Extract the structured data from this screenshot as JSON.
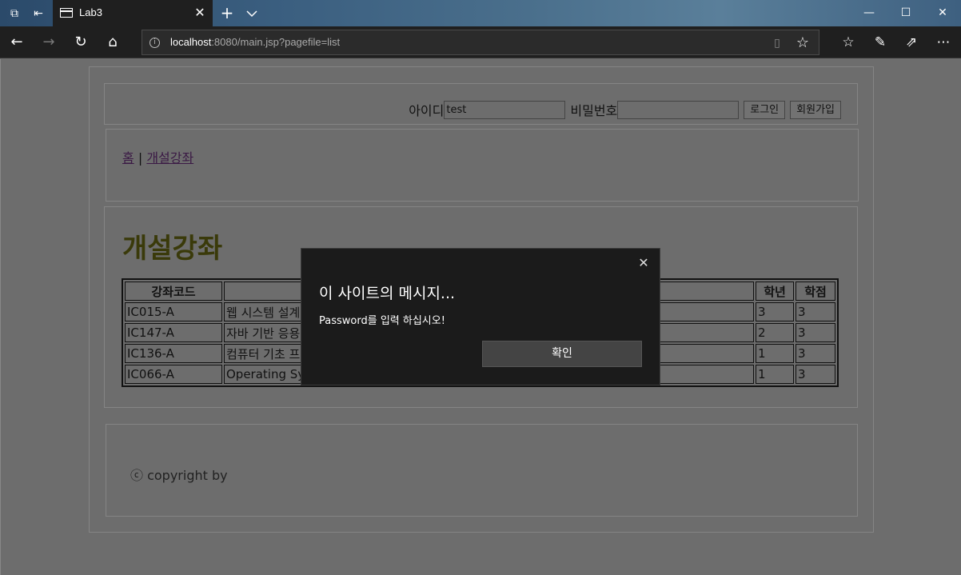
{
  "browser": {
    "tab_title": "Lab3",
    "url_host": "localhost",
    "url_rest": ":8080/main.jsp?pagefile=list"
  },
  "login": {
    "id_label": "아이디",
    "id_value": "test",
    "password_label": "비밀번호",
    "password_value": "",
    "login_button": "로그인",
    "signup_button": "회원가입"
  },
  "nav": {
    "home_link": "홈",
    "separator": "|",
    "courses_link": "개설강좌"
  },
  "content": {
    "heading": "개설강좌",
    "table": {
      "headers": [
        "강좌코드",
        "",
        "학년",
        "학점"
      ],
      "rows": [
        [
          "IC015-A",
          "웹 시스템 설계",
          "3",
          "3"
        ],
        [
          "IC147-A",
          "자바 기반 응용",
          "2",
          "3"
        ],
        [
          "IC136-A",
          "컴퓨터 기초 프",
          "1",
          "3"
        ],
        [
          "IC066-A",
          "Operating Sys",
          "1",
          "3"
        ]
      ]
    }
  },
  "footer": {
    "text": "ⓒ copyright by"
  },
  "dialog": {
    "title": "이 사이트의 메시지...",
    "message": "Password를 입력 하십시오!",
    "ok_button": "확인"
  }
}
